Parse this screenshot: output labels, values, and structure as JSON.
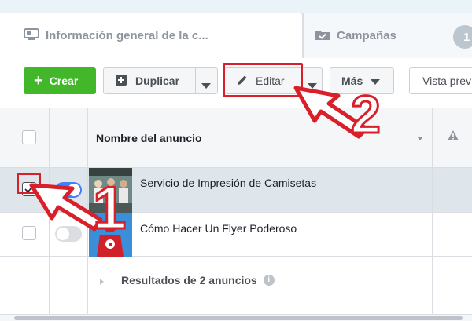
{
  "tabs": {
    "active": {
      "label": "Información general de la c..."
    },
    "inactive": {
      "label": "Campañas",
      "count": "1"
    }
  },
  "toolbar": {
    "create_label": "Crear",
    "duplicate_label": "Duplicar",
    "edit_label": "Editar",
    "more_label": "Más",
    "view_label": "Vista prev"
  },
  "table": {
    "column_header": "Nombre del anuncio",
    "rows": [
      {
        "name": "Servicio de Impresión de Camisetas",
        "checked": true,
        "active": true
      },
      {
        "name": "Cómo Hacer Un Flyer Poderoso",
        "checked": false,
        "active": false
      }
    ],
    "results_label": "Resultados de 2 anuncios"
  },
  "annotations": {
    "step1": "1",
    "step2": "2"
  },
  "colors": {
    "accent_create": "#42b72a",
    "annotation_red": "#d9202a",
    "toggle_on": "#4080ff"
  }
}
